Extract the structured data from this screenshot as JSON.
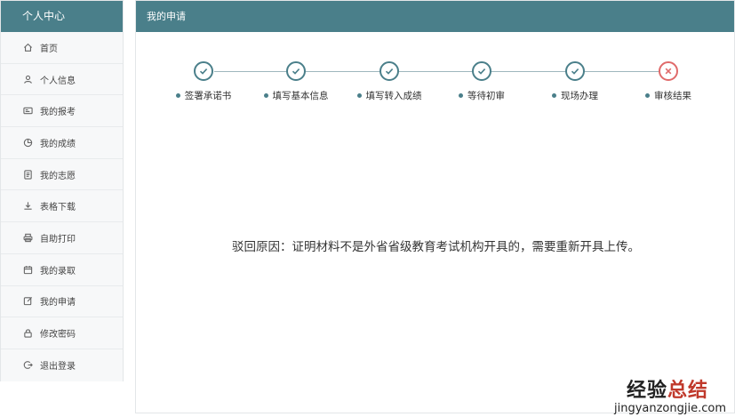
{
  "sidebar": {
    "title": "个人中心",
    "items": [
      {
        "label": "首页",
        "icon": "home-icon"
      },
      {
        "label": "个人信息",
        "icon": "user-icon"
      },
      {
        "label": "我的报考",
        "icon": "card-icon"
      },
      {
        "label": "我的成绩",
        "icon": "pie-chart-icon"
      },
      {
        "label": "我的志愿",
        "icon": "document-icon"
      },
      {
        "label": "表格下载",
        "icon": "download-icon"
      },
      {
        "label": "自助打印",
        "icon": "printer-icon"
      },
      {
        "label": "我的录取",
        "icon": "calendar-icon"
      },
      {
        "label": "我的申请",
        "icon": "edit-icon"
      },
      {
        "label": "修改密码",
        "icon": "lock-icon"
      },
      {
        "label": "退出登录",
        "icon": "logout-icon"
      }
    ]
  },
  "main": {
    "title": "我的申请",
    "steps": [
      {
        "label": "签署承诺书",
        "status": "done"
      },
      {
        "label": "填写基本信息",
        "status": "done"
      },
      {
        "label": "填写转入成绩",
        "status": "done"
      },
      {
        "label": "等待初审",
        "status": "done"
      },
      {
        "label": "现场办理",
        "status": "done"
      },
      {
        "label": "审核结果",
        "status": "failed"
      }
    ],
    "reason": "驳回原因：证明材料不是外省省级教育考试机构开具的，需要重新开具上传。"
  },
  "watermark": {
    "text_a": "经验",
    "text_b": "总结",
    "url": "jingyanzongjie.com"
  },
  "colors": {
    "accent": "#4a7f8a",
    "fail": "#e06a6a"
  }
}
